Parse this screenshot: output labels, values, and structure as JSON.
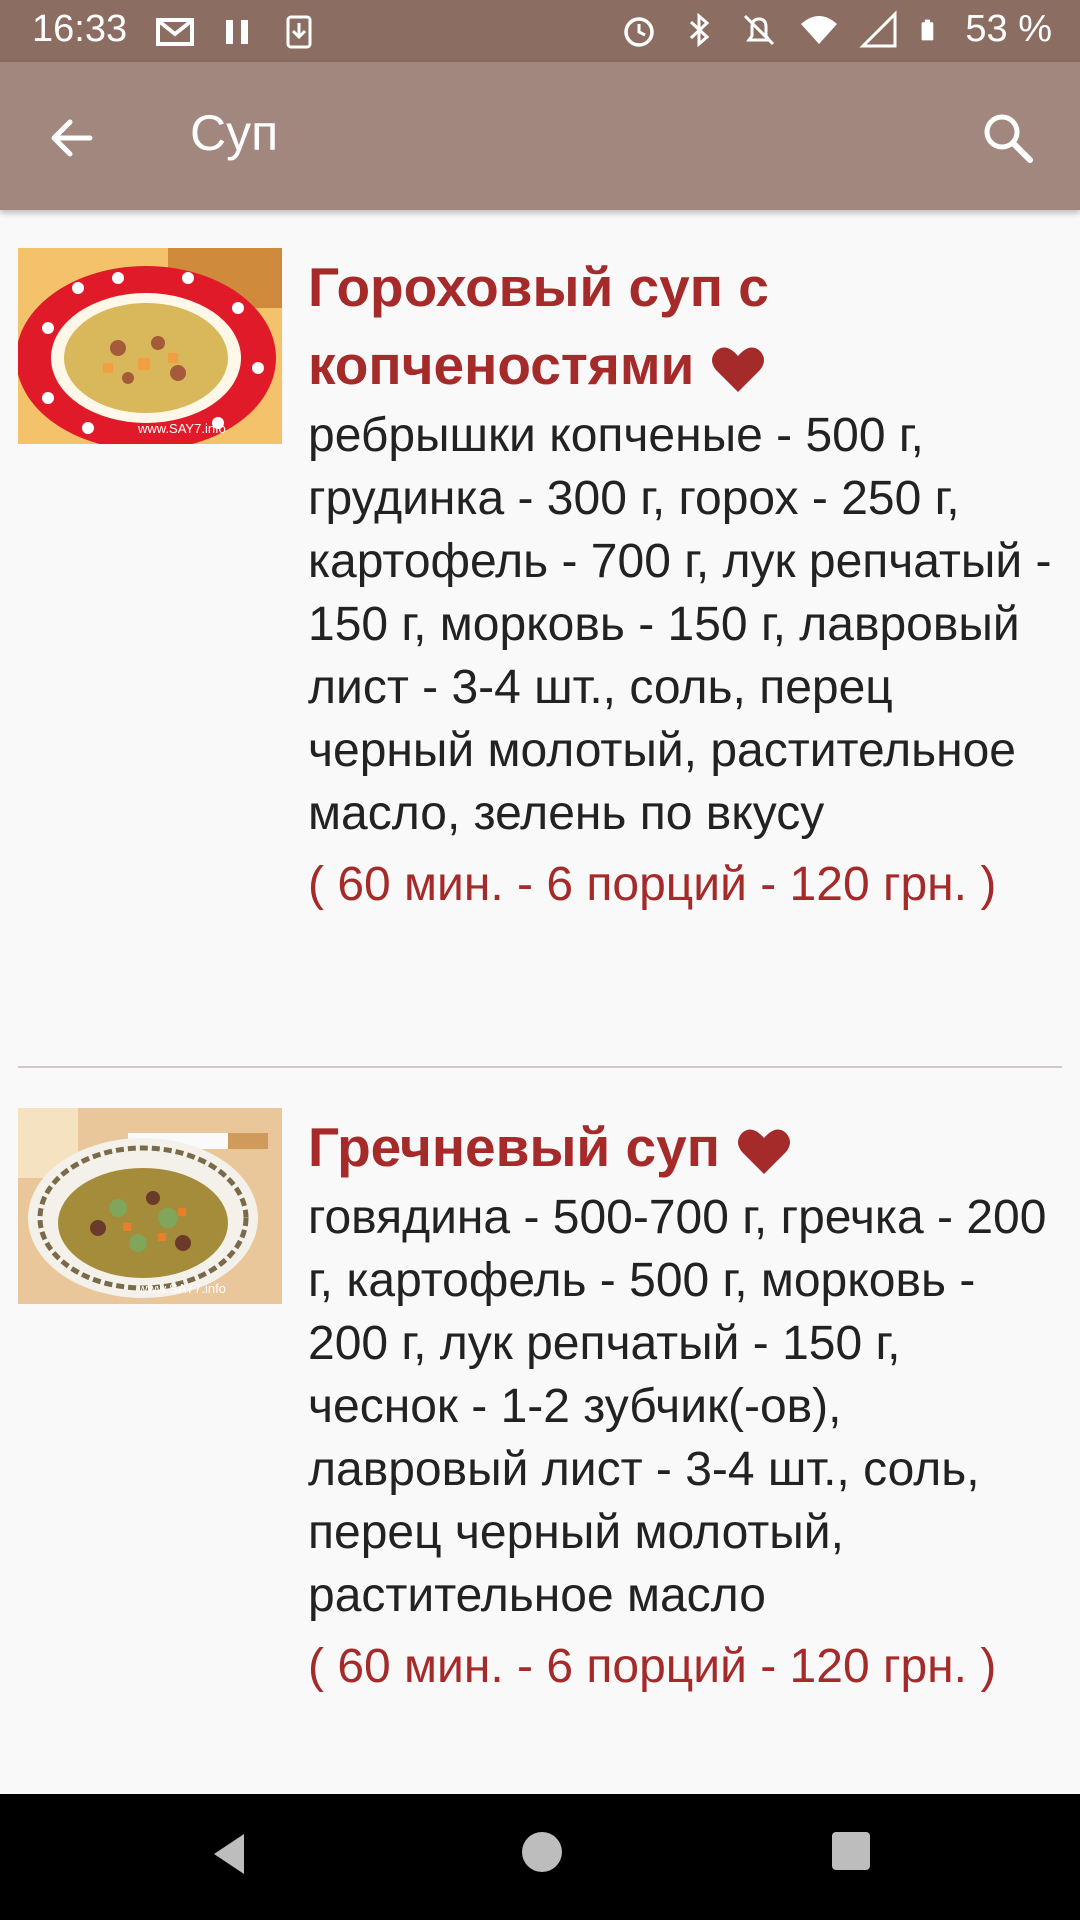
{
  "status": {
    "time": "16:33",
    "battery": "53 %"
  },
  "appbar": {
    "title": "Суп"
  },
  "recipes": [
    {
      "title_line1": "Гороховый суп с",
      "title_line2": "копченостями",
      "ingredients": "ребрышки копченые - 500 г, грудинка - 300 г, горох - 250 г, картофель - 700 г, лук репчатый - 150 г, морковь - 150 г, лавровый лист - 3-4 шт., соль, перец черный молотый, растительное масло, зелень по вкусу",
      "meta": "( 60 мин. - 6 порций - 120 грн. )",
      "watermark": "www.SAY7.info"
    },
    {
      "title_line1": "Гречневый суп",
      "title_line2": "",
      "ingredients": "говядина - 500-700 г, гречка - 200 г, картофель - 500 г, морковь - 200 г, лук репчатый - 150 г, чеснок - 1-2 зубчик(-ов), лавровый лист - 3-4 шт., соль, перец черный молотый, растительное масло",
      "meta": "( 60 мин. - 6 порций - 120 грн. )",
      "watermark": "www.SAY7.info"
    }
  ],
  "colors": {
    "status_bar": "#8b6d62",
    "app_bar": "#a1877d",
    "accent": "#a52a2a"
  },
  "icons": [
    "back-arrow-icon",
    "search-icon",
    "heart-icon",
    "nav-back-icon",
    "nav-home-icon",
    "nav-recents-icon"
  ]
}
